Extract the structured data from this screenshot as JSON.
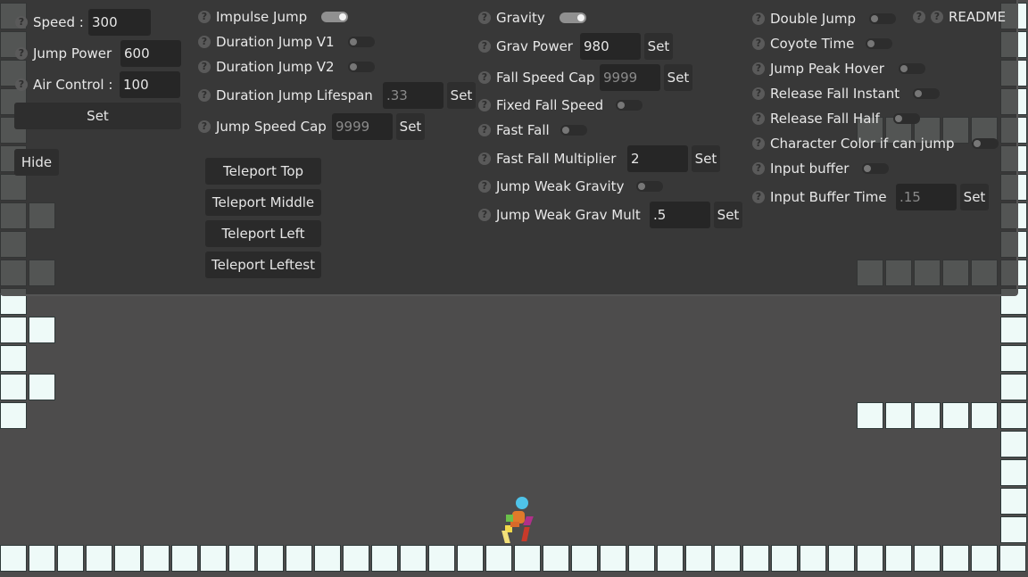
{
  "colors": {
    "background": "#4d4c4c",
    "panel": "#343434",
    "tile": "#eefaf8",
    "toggle_on": "#f2f2f2"
  },
  "help_icon": "?",
  "left_controls": {
    "speed": {
      "label": "Speed :",
      "value": "300"
    },
    "jump_power": {
      "label": "Jump Power",
      "value": "600"
    },
    "air_control": {
      "label": "Air Control :",
      "value": "100"
    },
    "set_label": "Set",
    "hide_label": "Hide"
  },
  "col2": {
    "impulse_jump": {
      "label": "Impulse Jump",
      "on": true
    },
    "duration_jump_v1": {
      "label": "Duration Jump V1",
      "on": false
    },
    "duration_jump_v2": {
      "label": "Duration Jump V2",
      "on": false
    },
    "duration_jump_lifespan": {
      "label": "Duration Jump Lifespan",
      "placeholder": ".33",
      "set": "Set"
    },
    "jump_speed_cap": {
      "label": "Jump Speed Cap",
      "placeholder": "9999",
      "set": "Set"
    },
    "teleport_top": "Teleport Top",
    "teleport_middle": "Teleport Middle",
    "teleport_left": "Teleport Left",
    "teleport_leftest": "Teleport Leftest"
  },
  "col3": {
    "gravity": {
      "label": "Gravity",
      "on": true
    },
    "grav_power": {
      "label": "Grav Power",
      "value": "980",
      "set": "Set"
    },
    "fall_speed_cap": {
      "label": "Fall Speed Cap",
      "placeholder": "9999",
      "set": "Set"
    },
    "fixed_fall_speed": {
      "label": "Fixed Fall Speed",
      "on": false
    },
    "fast_fall": {
      "label": "Fast Fall",
      "on": false
    },
    "fast_fall_multiplier": {
      "label": "Fast Fall Multiplier",
      "value": "2",
      "set": "Set"
    },
    "jump_weak_gravity": {
      "label": "Jump Weak Gravity",
      "on": false
    },
    "jump_weak_grav_mult": {
      "label": "Jump Weak Grav Mult",
      "value": ".5",
      "set": "Set"
    }
  },
  "col4": {
    "double_jump": {
      "label": "Double Jump",
      "on": false
    },
    "coyote_time": {
      "label": "Coyote Time",
      "on": false
    },
    "jump_peak_hover": {
      "label": "Jump Peak Hover",
      "on": false
    },
    "release_fall_instant": {
      "label": "Release Fall Instant",
      "on": false
    },
    "release_fall_half": {
      "label": "Release Fall Half",
      "on": false
    },
    "character_color": {
      "label": "Character Color if can jump",
      "on": false
    },
    "input_buffer": {
      "label": "Input buffer",
      "on": false
    },
    "input_buffer_time": {
      "label": "Input Buffer Time",
      "placeholder": ".15",
      "set": "Set"
    }
  },
  "readme_label": "README"
}
